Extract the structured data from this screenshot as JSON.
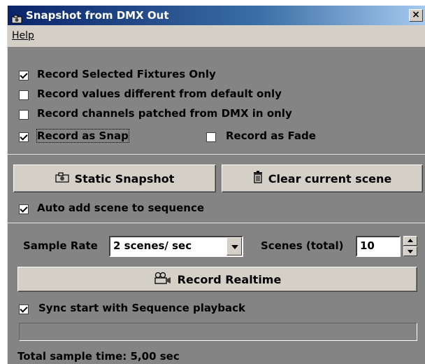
{
  "window": {
    "title": "Snapshot from DMX Out",
    "close_label": "×"
  },
  "menu": {
    "items": [
      {
        "label": "Help"
      }
    ]
  },
  "options": {
    "record_selected_fixtures_only": {
      "label": "Record Selected Fixtures Only",
      "checked": true
    },
    "record_values_different": {
      "label": "Record values different from default only",
      "checked": false
    },
    "record_channels_patched": {
      "label": "Record channels patched from DMX in only",
      "checked": false
    },
    "record_as_snap": {
      "label": "Record as Snap",
      "checked": true
    },
    "record_as_fade": {
      "label": "Record as Fade",
      "checked": false
    }
  },
  "snapshot": {
    "static_snapshot_label": "Static Snapshot",
    "clear_scene_label": "Clear current scene",
    "auto_add": {
      "label": "Auto add scene to sequence",
      "checked": true
    }
  },
  "realtime": {
    "sample_rate_label": "Sample Rate",
    "sample_rate_value": "2 scenes/ sec",
    "scenes_total_label": "Scenes (total)",
    "scenes_total_value": "10",
    "record_realtime_label": "Record Realtime",
    "sync_start": {
      "label": "Sync start with Sequence playback",
      "checked": true
    },
    "progress_fraction": 0,
    "total_sample_time": "Total sample time: 5,00 sec"
  },
  "icons": {
    "title": "camera-icon",
    "static_snapshot": "camera-icon",
    "clear_scene": "trash-icon",
    "record_realtime": "video-camera-icon"
  },
  "colors": {
    "titlebar_start": "#0a246a",
    "titlebar_end": "#a6caf0",
    "panel_bg": "#848484",
    "button_face": "#d4d0c8"
  }
}
